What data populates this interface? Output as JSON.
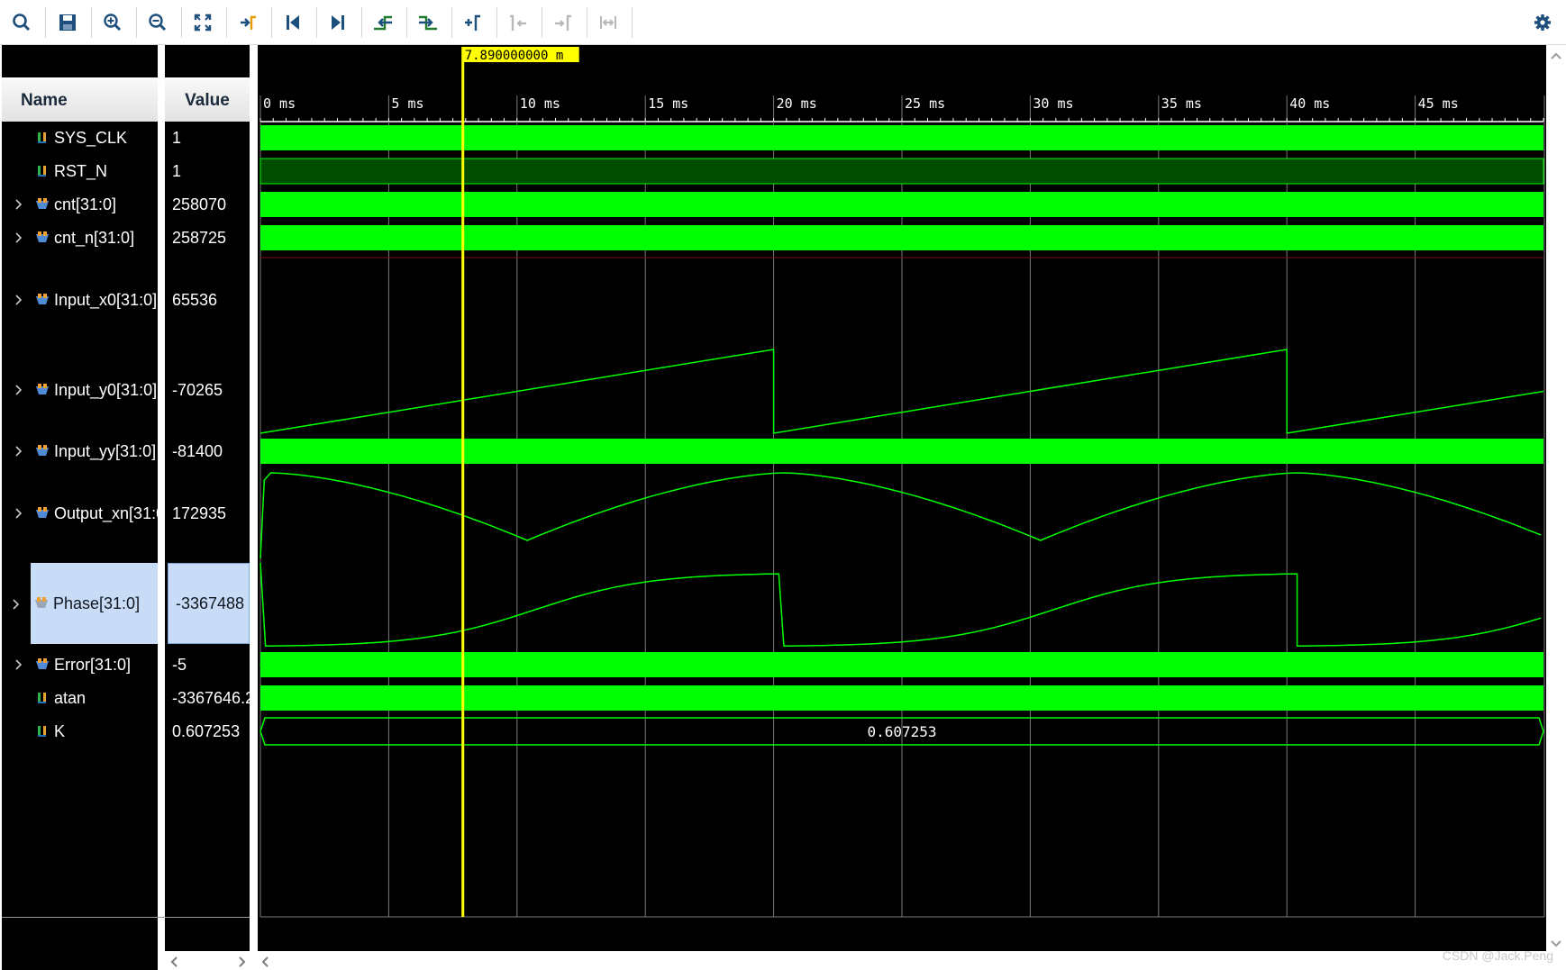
{
  "toolbar": {
    "buttons": [
      {
        "name": "search-icon",
        "enabled": true
      },
      {
        "name": "save-icon",
        "enabled": true
      },
      {
        "name": "zoom-in-icon",
        "enabled": true
      },
      {
        "name": "zoom-out-icon",
        "enabled": true
      },
      {
        "name": "zoom-fit-icon",
        "enabled": true
      },
      {
        "name": "go-to-cursor-icon",
        "enabled": true
      },
      {
        "name": "go-to-time-zero-icon",
        "enabled": true
      },
      {
        "name": "go-to-last-time-icon",
        "enabled": true
      },
      {
        "name": "previous-transition-icon",
        "enabled": true
      },
      {
        "name": "next-transition-icon",
        "enabled": true
      },
      {
        "name": "add-marker-icon",
        "enabled": true
      },
      {
        "name": "previous-marker-icon",
        "enabled": false
      },
      {
        "name": "next-marker-icon",
        "enabled": false
      },
      {
        "name": "swap-cursors-icon",
        "enabled": false
      }
    ],
    "settings_icon": "gear-icon"
  },
  "columns": {
    "name": "Name",
    "value": "Value"
  },
  "signals": [
    {
      "name": "SYS_CLK",
      "value": "1",
      "icon": "bit-signal-icon",
      "expandable": false
    },
    {
      "name": "RST_N",
      "value": "1",
      "icon": "bit-signal-icon",
      "expandable": false
    },
    {
      "name": "cnt[31:0]",
      "value": "258070",
      "icon": "bus-signal-icon",
      "expandable": true
    },
    {
      "name": "cnt_n[31:0]",
      "value": "258725",
      "icon": "bus-signal-icon",
      "expandable": true
    },
    {
      "name": "Input_x0[31:0]",
      "value": "65536",
      "icon": "bus-signal-icon",
      "expandable": true
    },
    {
      "name": "Input_y0[31:0]",
      "value": "-70265",
      "icon": "bus-signal-icon",
      "expandable": true
    },
    {
      "name": "Input_yy[31:0]",
      "value": "-81400",
      "icon": "bus-signal-icon",
      "expandable": true
    },
    {
      "name": "Output_xn[31:0]",
      "value": "172935",
      "icon": "bus-signal-icon",
      "expandable": true
    },
    {
      "name": "Phase[31:0]",
      "value": "-3367488",
      "icon": "bus-signal-icon",
      "expandable": true,
      "selected": true
    },
    {
      "name": "Error[31:0]",
      "value": "-5",
      "icon": "bus-signal-icon",
      "expandable": true
    },
    {
      "name": "atan",
      "value": "-3367646.2",
      "icon": "bit-signal-icon",
      "expandable": false
    },
    {
      "name": "K",
      "value": "0.607253",
      "icon": "bit-signal-icon",
      "expandable": false
    }
  ],
  "timeline": {
    "cursor_label": "7.890000000 m",
    "cursor_time_ms": 7.89,
    "range_ms": [
      0,
      50
    ],
    "tick_labels": [
      "0 ms",
      "5 ms",
      "10 ms",
      "15 ms",
      "20 ms",
      "25 ms",
      "30 ms",
      "35 ms",
      "40 ms",
      "45 ms"
    ],
    "k_bus_value": "0.607253"
  },
  "colors": {
    "waveform": "#00ff00",
    "reset_bus": "#004d00",
    "cursor": "#ffff00",
    "background": "#000000",
    "grid": "#7a7a7a",
    "selected_row": "#c9dcf7"
  },
  "watermark": "CSDN @Jack.Peng"
}
